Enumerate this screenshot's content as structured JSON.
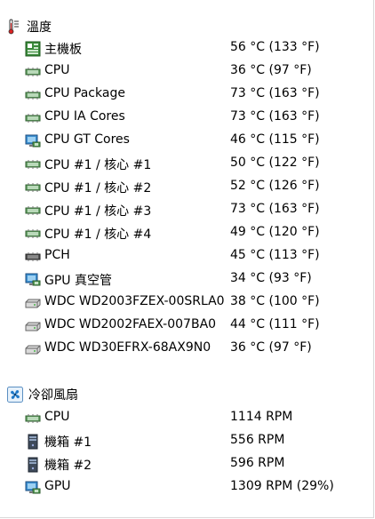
{
  "sections": [
    {
      "title": "溫度",
      "icon": "thermometer-icon",
      "rows": [
        {
          "icon": "motherboard-icon",
          "label": "主機板",
          "value": "56 °C  (133 °F)"
        },
        {
          "icon": "chip-icon",
          "label": "CPU",
          "value": "36 °C  (97 °F)"
        },
        {
          "icon": "chip-icon",
          "label": "CPU Package",
          "value": "73 °C  (163 °F)"
        },
        {
          "icon": "chip-icon",
          "label": "CPU IA Cores",
          "value": "73 °C  (163 °F)"
        },
        {
          "icon": "gpu-monitor-icon",
          "label": "CPU GT Cores",
          "value": "46 °C  (115 °F)"
        },
        {
          "icon": "chip-icon",
          "label": "CPU #1 / 核心 #1",
          "value": "50 °C  (122 °F)"
        },
        {
          "icon": "chip-icon",
          "label": "CPU #1 / 核心 #2",
          "value": "52 °C  (126 °F)"
        },
        {
          "icon": "chip-icon",
          "label": "CPU #1 / 核心 #3",
          "value": "73 °C  (163 °F)"
        },
        {
          "icon": "chip-icon",
          "label": "CPU #1 / 核心 #4",
          "value": "49 °C  (120 °F)"
        },
        {
          "icon": "pch-chip-icon",
          "label": "PCH",
          "value": "45 °C  (113 °F)"
        },
        {
          "icon": "gpu-monitor-icon",
          "label": "GPU 真空管",
          "value": "34 °C  (93 °F)"
        },
        {
          "icon": "hard-drive-icon",
          "label": "WDC WD2003FZEX-00SRLA0",
          "value": "38 °C  (100 °F)"
        },
        {
          "icon": "hard-drive-icon",
          "label": "WDC WD2002FAEX-007BA0",
          "value": "44 °C  (111 °F)"
        },
        {
          "icon": "hard-drive-icon",
          "label": "WDC WD30EFRX-68AX9N0",
          "value": "36 °C  (97 °F)"
        }
      ]
    },
    {
      "title": "冷卻風扇",
      "icon": "fan-icon",
      "rows": [
        {
          "icon": "chip-icon",
          "label": "CPU",
          "value": "1114 RPM"
        },
        {
          "icon": "case-icon",
          "label": "機箱 #1",
          "value": "556 RPM"
        },
        {
          "icon": "case-icon",
          "label": "機箱 #2",
          "value": "596 RPM"
        },
        {
          "icon": "gpu-monitor-icon",
          "label": "GPU",
          "value": "1309 RPM  (29%)"
        }
      ]
    }
  ]
}
